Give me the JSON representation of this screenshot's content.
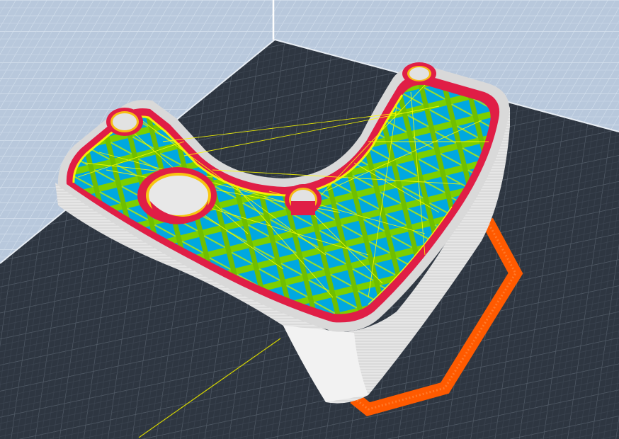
{
  "viewer": {
    "scene": "sliced-part-preview-3d",
    "colors": {
      "background_wall": "#b8c8dc",
      "wall_grid": "#d8e4f0",
      "build_plate": "#2e3641",
      "plate_grid": "#56606c",
      "outer_wall": "#d9d9d9",
      "inner_wall": "#e01e46",
      "infill": "#7ccf00",
      "top_bottom_skin": "#00a8e0",
      "travel_moves": "#ffff00",
      "skirt": "#ff5a00",
      "axis_line": "#d4d400"
    },
    "feature_types": [
      "outer-wall",
      "inner-wall",
      "infill",
      "skin",
      "travel",
      "skirt"
    ]
  }
}
